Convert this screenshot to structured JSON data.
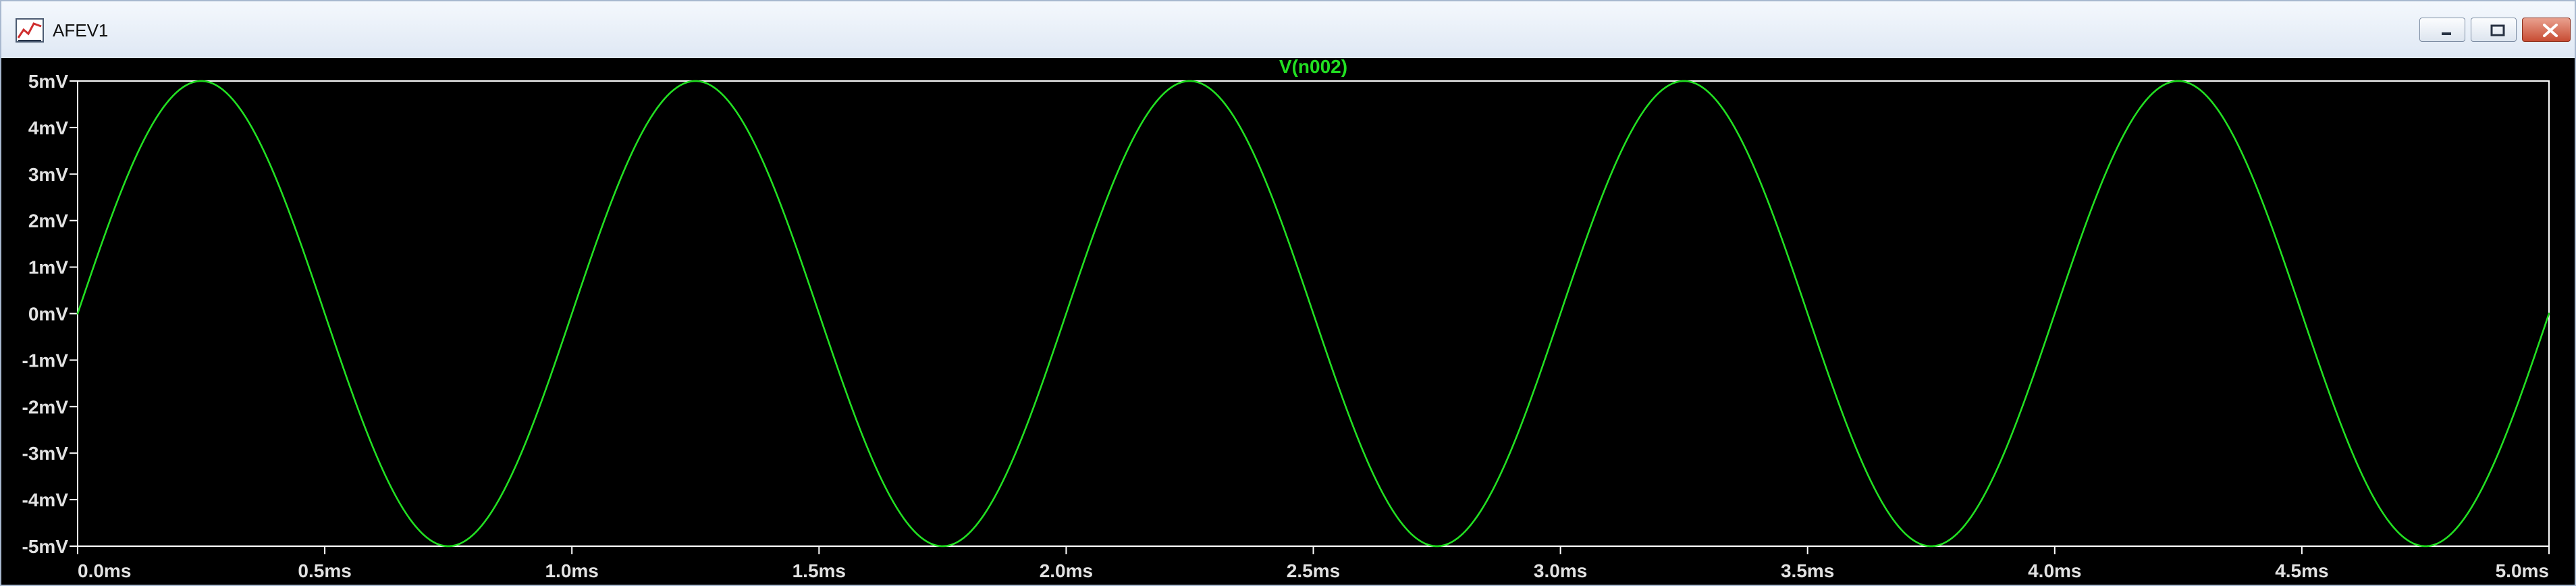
{
  "window": {
    "title": "AFEV1",
    "icon": "waveform-chart-icon",
    "controls": [
      "minimize-icon",
      "maximize-icon",
      "close-icon"
    ]
  },
  "colors": {
    "plot_background": "#000000",
    "trace": "#22e022",
    "axis_labels": "#e2e2e2",
    "frame": "#ffffff"
  },
  "chart_data": {
    "type": "line",
    "title": "V(n002)",
    "series": [
      {
        "name": "V(n002)",
        "function": "sine",
        "amplitude_mV": 5,
        "offset_mV": 0,
        "frequency_kHz": 1,
        "phase_deg": 0,
        "x_range_ms": [
          0,
          5
        ],
        "peaks_ms": [
          0.25,
          1.25,
          2.25,
          3.25,
          4.25
        ],
        "troughs_ms": [
          0.75,
          1.75,
          2.75,
          3.75,
          4.75
        ],
        "color": "#22e022"
      }
    ],
    "x_axis": {
      "unit": "ms",
      "range": [
        0,
        5
      ],
      "ticks": [
        "0.0ms",
        "0.5ms",
        "1.0ms",
        "1.5ms",
        "2.0ms",
        "2.5ms",
        "3.0ms",
        "3.5ms",
        "4.0ms",
        "4.5ms",
        "5.0ms"
      ]
    },
    "y_axis": {
      "unit": "mV",
      "range": [
        -5,
        5
      ],
      "ticks": [
        "5mV",
        "4mV",
        "3mV",
        "2mV",
        "1mV",
        "0mV",
        "-1mV",
        "-2mV",
        "-3mV",
        "-4mV",
        "-5mV"
      ]
    },
    "grid": false,
    "legend": "top-center"
  }
}
